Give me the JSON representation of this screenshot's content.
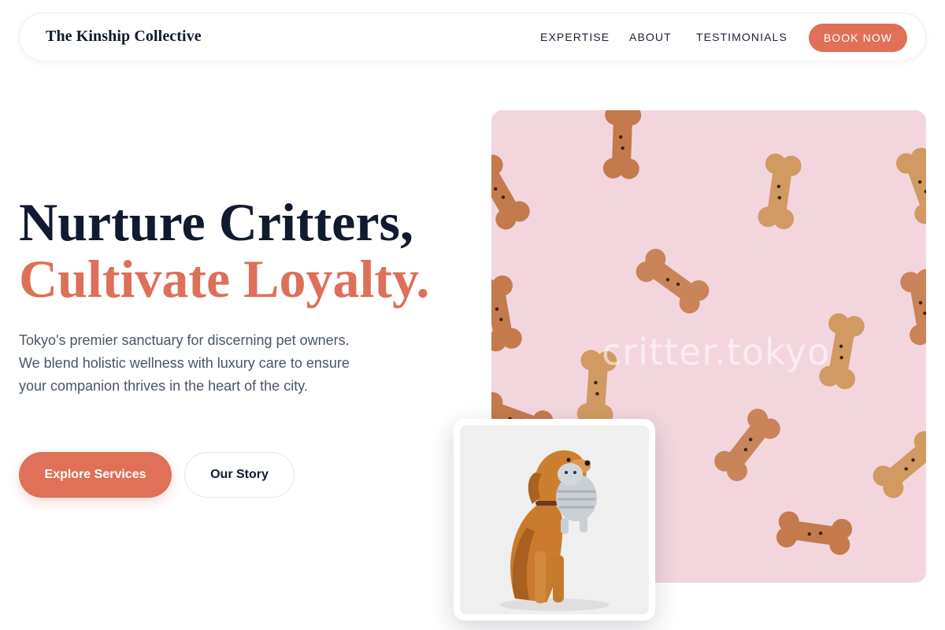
{
  "brand": "The Kinship Collective",
  "nav": {
    "links": [
      "EXPERTISE",
      "ABOUT",
      "TESTIMONIALS"
    ],
    "cta": "BOOK NOW"
  },
  "hero": {
    "headline_line1": "Nurture Critters,",
    "headline_line2": "Cultivate Loyalty.",
    "lede": "Tokyo's premier sanctuary for discerning pet owners. We blend holistic wellness with luxury care to ensure your companion thrives in the heart of the city.",
    "primary_button": "Explore Services",
    "secondary_button": "Our Story"
  },
  "images": {
    "main_watermark": "critter.tokyo",
    "main_subject": "dog biscuits on pink background",
    "inset_subject": "golden dog holding plush toy"
  },
  "colors": {
    "accent": "#e07058",
    "heading": "#111a2e",
    "body_text": "#4a5568",
    "image_bg": "#f3d6dd"
  }
}
